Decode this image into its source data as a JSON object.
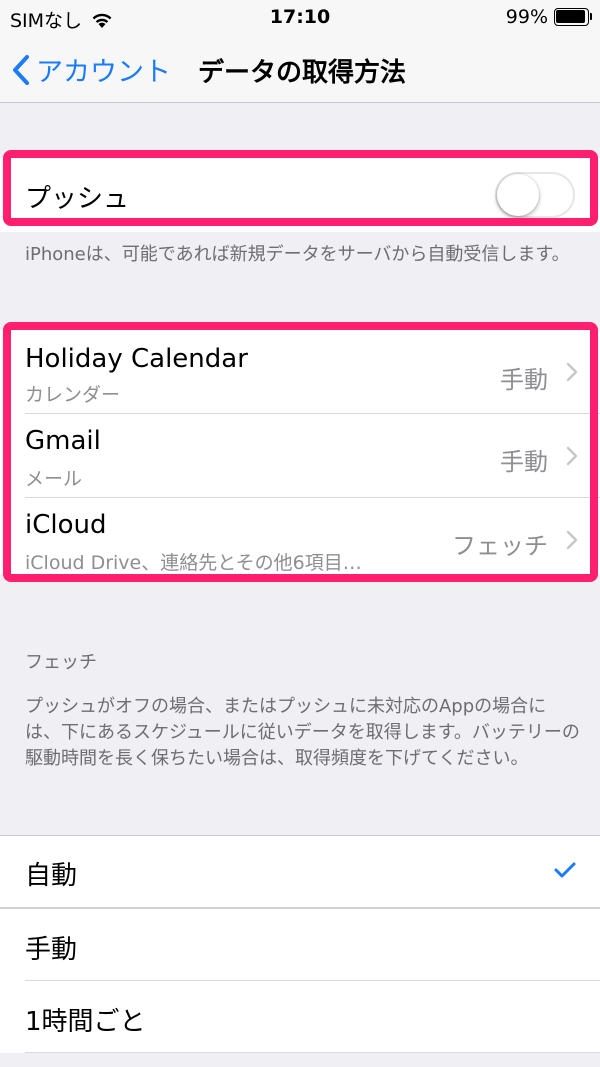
{
  "status_bar": {
    "carrier": "SIMなし",
    "time": "17:10",
    "battery": "99%",
    "battery_level": 0.99
  },
  "nav": {
    "back_label": "アカウント",
    "title": "データの取得方法"
  },
  "push": {
    "label": "プッシュ",
    "enabled": false,
    "footer": "iPhoneは、可能であれば新規データをサーバから自動受信します。"
  },
  "accounts": [
    {
      "name": "Holiday Calendar",
      "detail": "カレンダー",
      "mode": "手動"
    },
    {
      "name": "Gmail",
      "detail": "メール",
      "mode": "手動"
    },
    {
      "name": "iCloud",
      "detail": "iCloud Drive、連絡先とその他6項目…",
      "mode": "フェッチ"
    }
  ],
  "fetch": {
    "header": "フェッチ",
    "description": "プッシュがオフの場合、またはプッシュに未対応のAppの場合には、下にあるスケジュールに従いデータを取得します。バッテリーの駆動時間を長く保ちたい場合は、取得頻度を下げてください。",
    "options": [
      {
        "label": "自動",
        "selected": true
      },
      {
        "label": "手動",
        "selected": false
      },
      {
        "label": "1時間ごと",
        "selected": false
      }
    ]
  },
  "colors": {
    "accent": "#1a7cf8",
    "highlight": "#ff1f6e",
    "background": "#efeff4"
  },
  "icons": [
    "wifi-icon",
    "battery-icon",
    "back-chevron-icon",
    "chevron-right-icon",
    "checkmark-icon"
  ]
}
